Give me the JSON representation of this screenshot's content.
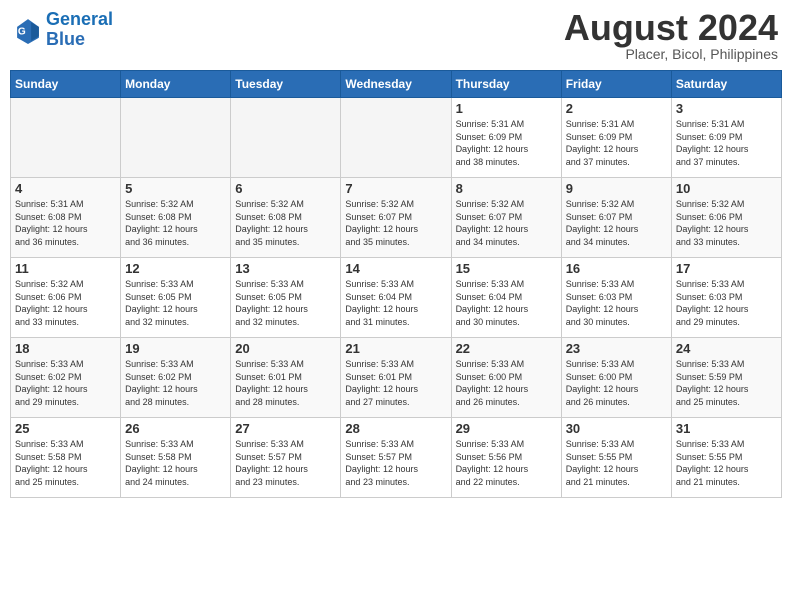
{
  "header": {
    "logo_line1": "General",
    "logo_line2": "Blue",
    "month_year": "August 2024",
    "location": "Placer, Bicol, Philippines"
  },
  "days_of_week": [
    "Sunday",
    "Monday",
    "Tuesday",
    "Wednesday",
    "Thursday",
    "Friday",
    "Saturday"
  ],
  "weeks": [
    [
      {
        "day": "",
        "info": ""
      },
      {
        "day": "",
        "info": ""
      },
      {
        "day": "",
        "info": ""
      },
      {
        "day": "",
        "info": ""
      },
      {
        "day": "1",
        "info": "Sunrise: 5:31 AM\nSunset: 6:09 PM\nDaylight: 12 hours\nand 38 minutes."
      },
      {
        "day": "2",
        "info": "Sunrise: 5:31 AM\nSunset: 6:09 PM\nDaylight: 12 hours\nand 37 minutes."
      },
      {
        "day": "3",
        "info": "Sunrise: 5:31 AM\nSunset: 6:09 PM\nDaylight: 12 hours\nand 37 minutes."
      }
    ],
    [
      {
        "day": "4",
        "info": "Sunrise: 5:31 AM\nSunset: 6:08 PM\nDaylight: 12 hours\nand 36 minutes."
      },
      {
        "day": "5",
        "info": "Sunrise: 5:32 AM\nSunset: 6:08 PM\nDaylight: 12 hours\nand 36 minutes."
      },
      {
        "day": "6",
        "info": "Sunrise: 5:32 AM\nSunset: 6:08 PM\nDaylight: 12 hours\nand 35 minutes."
      },
      {
        "day": "7",
        "info": "Sunrise: 5:32 AM\nSunset: 6:07 PM\nDaylight: 12 hours\nand 35 minutes."
      },
      {
        "day": "8",
        "info": "Sunrise: 5:32 AM\nSunset: 6:07 PM\nDaylight: 12 hours\nand 34 minutes."
      },
      {
        "day": "9",
        "info": "Sunrise: 5:32 AM\nSunset: 6:07 PM\nDaylight: 12 hours\nand 34 minutes."
      },
      {
        "day": "10",
        "info": "Sunrise: 5:32 AM\nSunset: 6:06 PM\nDaylight: 12 hours\nand 33 minutes."
      }
    ],
    [
      {
        "day": "11",
        "info": "Sunrise: 5:32 AM\nSunset: 6:06 PM\nDaylight: 12 hours\nand 33 minutes."
      },
      {
        "day": "12",
        "info": "Sunrise: 5:33 AM\nSunset: 6:05 PM\nDaylight: 12 hours\nand 32 minutes."
      },
      {
        "day": "13",
        "info": "Sunrise: 5:33 AM\nSunset: 6:05 PM\nDaylight: 12 hours\nand 32 minutes."
      },
      {
        "day": "14",
        "info": "Sunrise: 5:33 AM\nSunset: 6:04 PM\nDaylight: 12 hours\nand 31 minutes."
      },
      {
        "day": "15",
        "info": "Sunrise: 5:33 AM\nSunset: 6:04 PM\nDaylight: 12 hours\nand 30 minutes."
      },
      {
        "day": "16",
        "info": "Sunrise: 5:33 AM\nSunset: 6:03 PM\nDaylight: 12 hours\nand 30 minutes."
      },
      {
        "day": "17",
        "info": "Sunrise: 5:33 AM\nSunset: 6:03 PM\nDaylight: 12 hours\nand 29 minutes."
      }
    ],
    [
      {
        "day": "18",
        "info": "Sunrise: 5:33 AM\nSunset: 6:02 PM\nDaylight: 12 hours\nand 29 minutes."
      },
      {
        "day": "19",
        "info": "Sunrise: 5:33 AM\nSunset: 6:02 PM\nDaylight: 12 hours\nand 28 minutes."
      },
      {
        "day": "20",
        "info": "Sunrise: 5:33 AM\nSunset: 6:01 PM\nDaylight: 12 hours\nand 28 minutes."
      },
      {
        "day": "21",
        "info": "Sunrise: 5:33 AM\nSunset: 6:01 PM\nDaylight: 12 hours\nand 27 minutes."
      },
      {
        "day": "22",
        "info": "Sunrise: 5:33 AM\nSunset: 6:00 PM\nDaylight: 12 hours\nand 26 minutes."
      },
      {
        "day": "23",
        "info": "Sunrise: 5:33 AM\nSunset: 6:00 PM\nDaylight: 12 hours\nand 26 minutes."
      },
      {
        "day": "24",
        "info": "Sunrise: 5:33 AM\nSunset: 5:59 PM\nDaylight: 12 hours\nand 25 minutes."
      }
    ],
    [
      {
        "day": "25",
        "info": "Sunrise: 5:33 AM\nSunset: 5:58 PM\nDaylight: 12 hours\nand 25 minutes."
      },
      {
        "day": "26",
        "info": "Sunrise: 5:33 AM\nSunset: 5:58 PM\nDaylight: 12 hours\nand 24 minutes."
      },
      {
        "day": "27",
        "info": "Sunrise: 5:33 AM\nSunset: 5:57 PM\nDaylight: 12 hours\nand 23 minutes."
      },
      {
        "day": "28",
        "info": "Sunrise: 5:33 AM\nSunset: 5:57 PM\nDaylight: 12 hours\nand 23 minutes."
      },
      {
        "day": "29",
        "info": "Sunrise: 5:33 AM\nSunset: 5:56 PM\nDaylight: 12 hours\nand 22 minutes."
      },
      {
        "day": "30",
        "info": "Sunrise: 5:33 AM\nSunset: 5:55 PM\nDaylight: 12 hours\nand 21 minutes."
      },
      {
        "day": "31",
        "info": "Sunrise: 5:33 AM\nSunset: 5:55 PM\nDaylight: 12 hours\nand 21 minutes."
      }
    ]
  ]
}
